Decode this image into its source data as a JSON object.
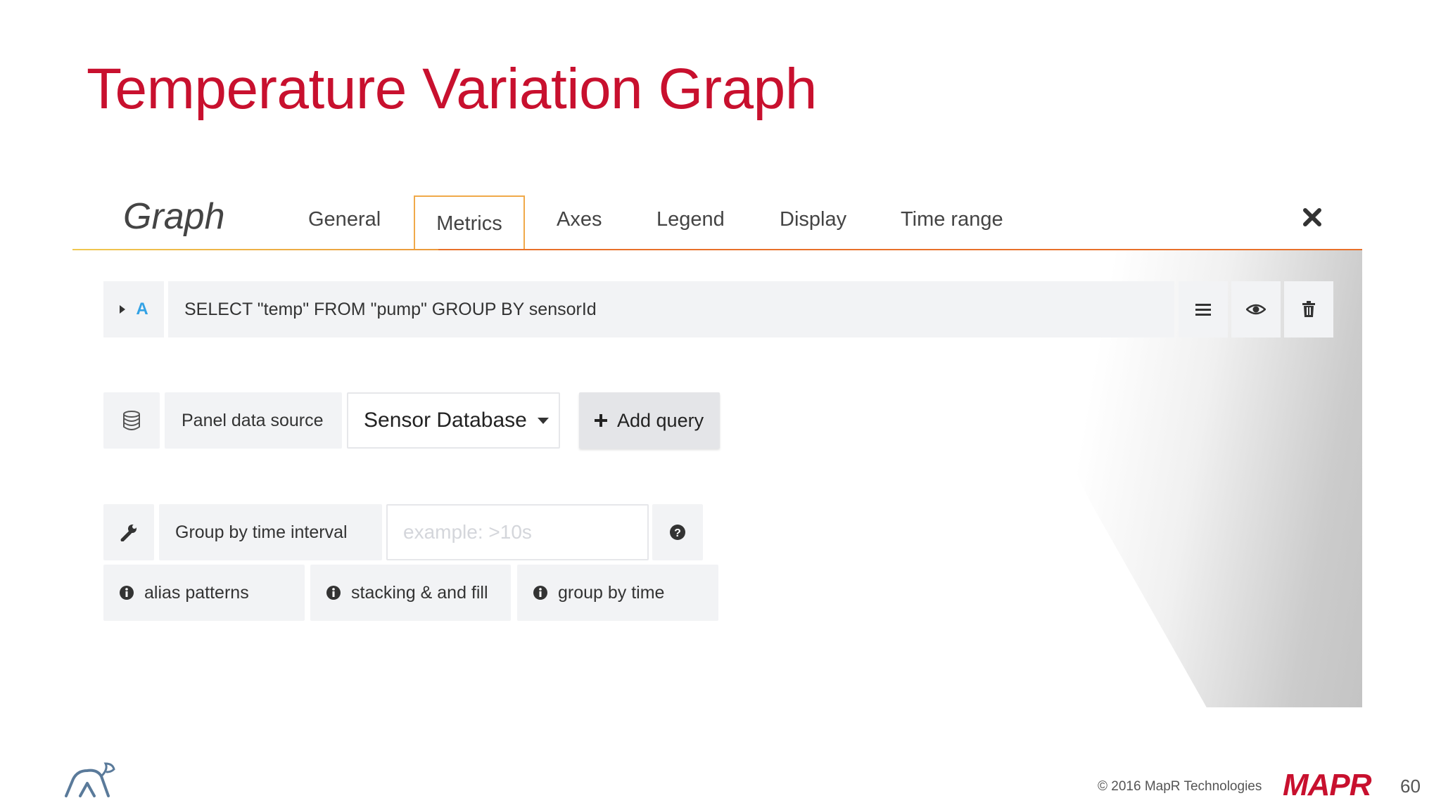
{
  "slide": {
    "title": "Temperature Variation Graph",
    "page_number": "60",
    "copyright": "© 2016 MapR Technologies",
    "brand": "MAPR"
  },
  "panel": {
    "name": "Graph",
    "tabs": [
      {
        "label": "General",
        "active": false
      },
      {
        "label": "Metrics",
        "active": true
      },
      {
        "label": "Axes",
        "active": false
      },
      {
        "label": "Legend",
        "active": false
      },
      {
        "label": "Display",
        "active": false
      },
      {
        "label": "Time range",
        "active": false
      }
    ],
    "close_icon": "close-icon"
  },
  "query": {
    "ref_id": "A",
    "text": "SELECT \"temp\" FROM \"pump\" GROUP BY sensorId",
    "actions": [
      "menu-icon",
      "eye-icon",
      "trash-icon"
    ]
  },
  "datasource": {
    "label": "Panel data source",
    "selected": "Sensor Database",
    "add_query_label": "Add query"
  },
  "group_by": {
    "label": "Group by time interval",
    "placeholder": "example: >10s",
    "value": ""
  },
  "help_buttons": [
    {
      "label": "alias patterns"
    },
    {
      "label": "stacking & and fill"
    },
    {
      "label": "group by time"
    }
  ],
  "colors": {
    "title": "#c8102e",
    "tab_underline": "#e8702a",
    "query_ref": "#33a2e5"
  }
}
